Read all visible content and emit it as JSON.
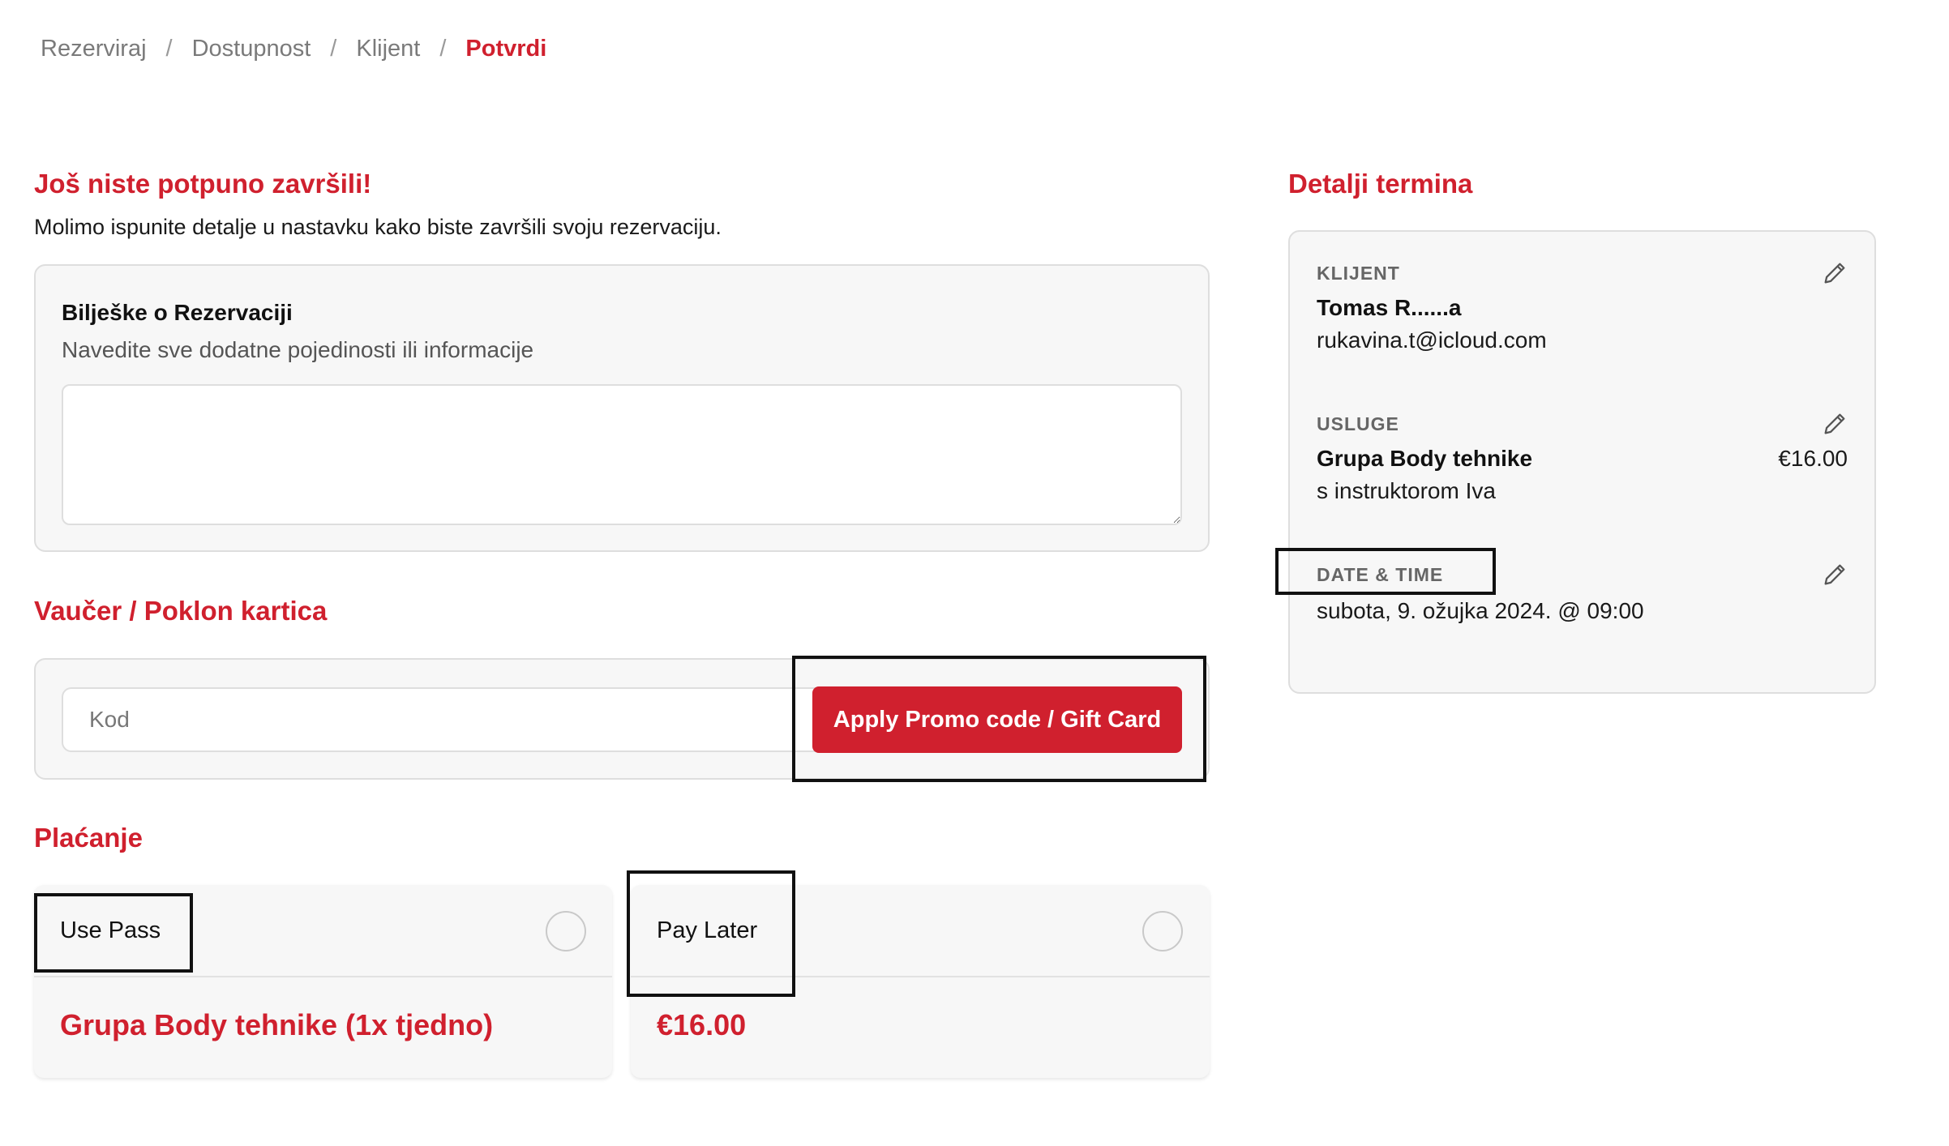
{
  "breadcrumb": {
    "items": [
      "Rezerviraj",
      "Dostupnost",
      "Klijent"
    ],
    "active": "Potvrdi",
    "separator": "/"
  },
  "intro": {
    "title": "Još niste potpuno završili!",
    "subtitle": "Molimo ispunite detalje u nastavku kako biste završili svoju rezervaciju."
  },
  "notes": {
    "title": "Bilješke o Rezervaciji",
    "description": "Navedite sve dodatne pojedinosti ili informacije",
    "value": ""
  },
  "voucher": {
    "title": "Vaučer / Poklon kartica",
    "placeholder": "Kod",
    "button_label": "Apply Promo code / Gift Card"
  },
  "payment": {
    "title": "Plaćanje",
    "options": [
      {
        "label": "Use Pass",
        "value": "Grupa Body tehnike (1x tjedno)",
        "selected": false
      },
      {
        "label": "Pay Later",
        "value": "€16.00",
        "selected": false
      }
    ]
  },
  "details": {
    "title": "Detalji termina",
    "client": {
      "label": "KLIJENT",
      "name": "Tomas R......a",
      "email": "rukavina.t@icloud.com"
    },
    "services": {
      "label": "USLUGE",
      "name": "Grupa Body tehnike",
      "price": "€16.00",
      "instructor": "s instruktorom Iva"
    },
    "datetime": {
      "label": "DATE & TIME",
      "value": "subota, 9. ožujka 2024. @ 09:00"
    }
  },
  "colors": {
    "accent": "#d0202e",
    "panel_bg": "#f7f7f7",
    "border": "#dedede"
  },
  "icons": [
    "pencil-icon"
  ]
}
